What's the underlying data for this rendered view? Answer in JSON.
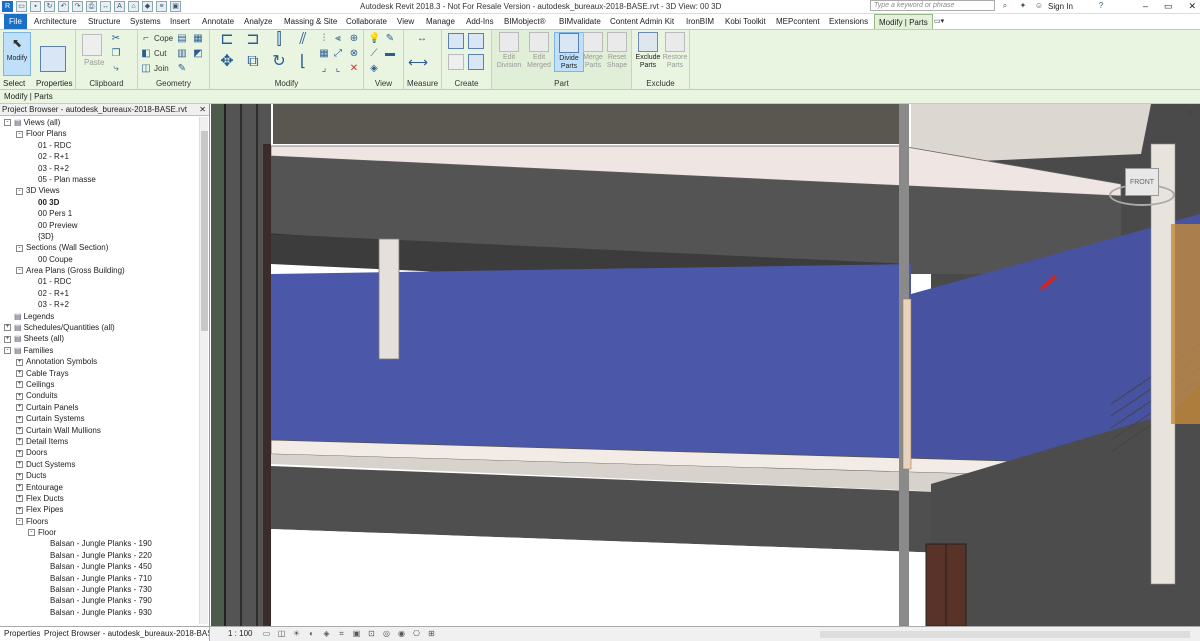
{
  "window": {
    "title": "Autodesk Revit 2018.3 - Not For Resale Version -   autodesk_bureaux-2018-BASE.rvt - 3D View: 00 3D",
    "search_placeholder": "Type a keyword or phrase",
    "sign_in": "Sign In"
  },
  "tabs": [
    "Architecture",
    "Structure",
    "Systems",
    "Insert",
    "Annotate",
    "Analyze",
    "Massing & Site",
    "Collaborate",
    "View",
    "Manage",
    "Add-Ins",
    "BIMobject®",
    "BIMvalidate",
    "Content Admin Kit",
    "IronBIM",
    "Kobi Toolkit",
    "MEPcontent",
    "Extensions"
  ],
  "file_tab": "File",
  "active_tab": "Modify | Parts",
  "ribbon": {
    "select": {
      "modify": "Modify",
      "select": "Select",
      "properties": "Properties"
    },
    "clipboard": {
      "paste": "Paste",
      "label": "Clipboard"
    },
    "geometry": {
      "cope": "Cope",
      "cut": "Cut",
      "join": "Join",
      "label": "Geometry"
    },
    "modify_label": "Modify",
    "view_label": "View",
    "measure_label": "Measure",
    "create_label": "Create",
    "part": {
      "edit_division": "Edit Division",
      "edit_merged": "Edit Merged",
      "divide_parts": "Divide Parts",
      "merge_parts": "Merge Parts",
      "reset_shape": "Reset Shape",
      "label": "Part"
    },
    "exclude": {
      "exclude_parts": "Exclude Parts",
      "restore_parts": "Restore Parts",
      "label": "Exclude"
    }
  },
  "context_bar": "Modify | Parts",
  "project_browser": {
    "header": "Project Browser - autodesk_bureaux-2018-BASE.rvt",
    "nodes": [
      {
        "d": 0,
        "t": "-",
        "label": "Views (all)",
        "icon": true
      },
      {
        "d": 1,
        "t": "-",
        "label": "Floor Plans"
      },
      {
        "d": 2,
        "t": "",
        "label": "01 - RDC"
      },
      {
        "d": 2,
        "t": "",
        "label": "02 - R+1"
      },
      {
        "d": 2,
        "t": "",
        "label": "03 - R+2"
      },
      {
        "d": 2,
        "t": "",
        "label": "05 - Plan masse"
      },
      {
        "d": 1,
        "t": "-",
        "label": "3D Views"
      },
      {
        "d": 2,
        "t": "",
        "label": "00 3D",
        "bold": true
      },
      {
        "d": 2,
        "t": "",
        "label": "00 Pers 1"
      },
      {
        "d": 2,
        "t": "",
        "label": "00 Preview"
      },
      {
        "d": 2,
        "t": "",
        "label": "{3D}"
      },
      {
        "d": 1,
        "t": "-",
        "label": "Sections (Wall Section)"
      },
      {
        "d": 2,
        "t": "",
        "label": "00 Coupe"
      },
      {
        "d": 1,
        "t": "-",
        "label": "Area Plans (Gross Building)"
      },
      {
        "d": 2,
        "t": "",
        "label": "01 - RDC"
      },
      {
        "d": 2,
        "t": "",
        "label": "02 - R+1"
      },
      {
        "d": 2,
        "t": "",
        "label": "03 - R+2"
      },
      {
        "d": 0,
        "t": "",
        "label": "Legends",
        "icon": true
      },
      {
        "d": 0,
        "t": "+",
        "label": "Schedules/Quantities (all)",
        "icon": true
      },
      {
        "d": 0,
        "t": "+",
        "label": "Sheets (all)",
        "icon": true
      },
      {
        "d": 0,
        "t": "-",
        "label": "Families",
        "icon": true
      },
      {
        "d": 1,
        "t": "+",
        "label": "Annotation Symbols"
      },
      {
        "d": 1,
        "t": "+",
        "label": "Cable Trays"
      },
      {
        "d": 1,
        "t": "+",
        "label": "Ceilings"
      },
      {
        "d": 1,
        "t": "+",
        "label": "Conduits"
      },
      {
        "d": 1,
        "t": "+",
        "label": "Curtain Panels"
      },
      {
        "d": 1,
        "t": "+",
        "label": "Curtain Systems"
      },
      {
        "d": 1,
        "t": "+",
        "label": "Curtain Wall Mullions"
      },
      {
        "d": 1,
        "t": "+",
        "label": "Detail Items"
      },
      {
        "d": 1,
        "t": "+",
        "label": "Doors"
      },
      {
        "d": 1,
        "t": "+",
        "label": "Duct Systems"
      },
      {
        "d": 1,
        "t": "+",
        "label": "Ducts"
      },
      {
        "d": 1,
        "t": "+",
        "label": "Entourage"
      },
      {
        "d": 1,
        "t": "+",
        "label": "Flex Ducts"
      },
      {
        "d": 1,
        "t": "+",
        "label": "Flex Pipes"
      },
      {
        "d": 1,
        "t": "-",
        "label": "Floors"
      },
      {
        "d": 2,
        "t": "-",
        "label": "Floor"
      },
      {
        "d": 3,
        "t": "",
        "label": "Balsan - Jungle Planks - 190"
      },
      {
        "d": 3,
        "t": "",
        "label": "Balsan - Jungle Planks - 220"
      },
      {
        "d": 3,
        "t": "",
        "label": "Balsan - Jungle Planks - 450"
      },
      {
        "d": 3,
        "t": "",
        "label": "Balsan - Jungle Planks - 710"
      },
      {
        "d": 3,
        "t": "",
        "label": "Balsan - Jungle Planks - 730"
      },
      {
        "d": 3,
        "t": "",
        "label": "Balsan - Jungle Planks - 790"
      },
      {
        "d": 3,
        "t": "",
        "label": "Balsan - Jungle Planks - 930"
      }
    ]
  },
  "status": {
    "properties_tab": "Properties",
    "browser_tab": "Project Browser - autodesk_bureaux-2018-BASE...",
    "scale": "1 : 100"
  },
  "viewcube_label": "FRONT",
  "colors": {
    "floor_blue": "#4450a0",
    "slab_edge": "#e8e0d8",
    "wall_dark": "#3a3a3a",
    "ribbon_bg": "#e9f5e1"
  }
}
